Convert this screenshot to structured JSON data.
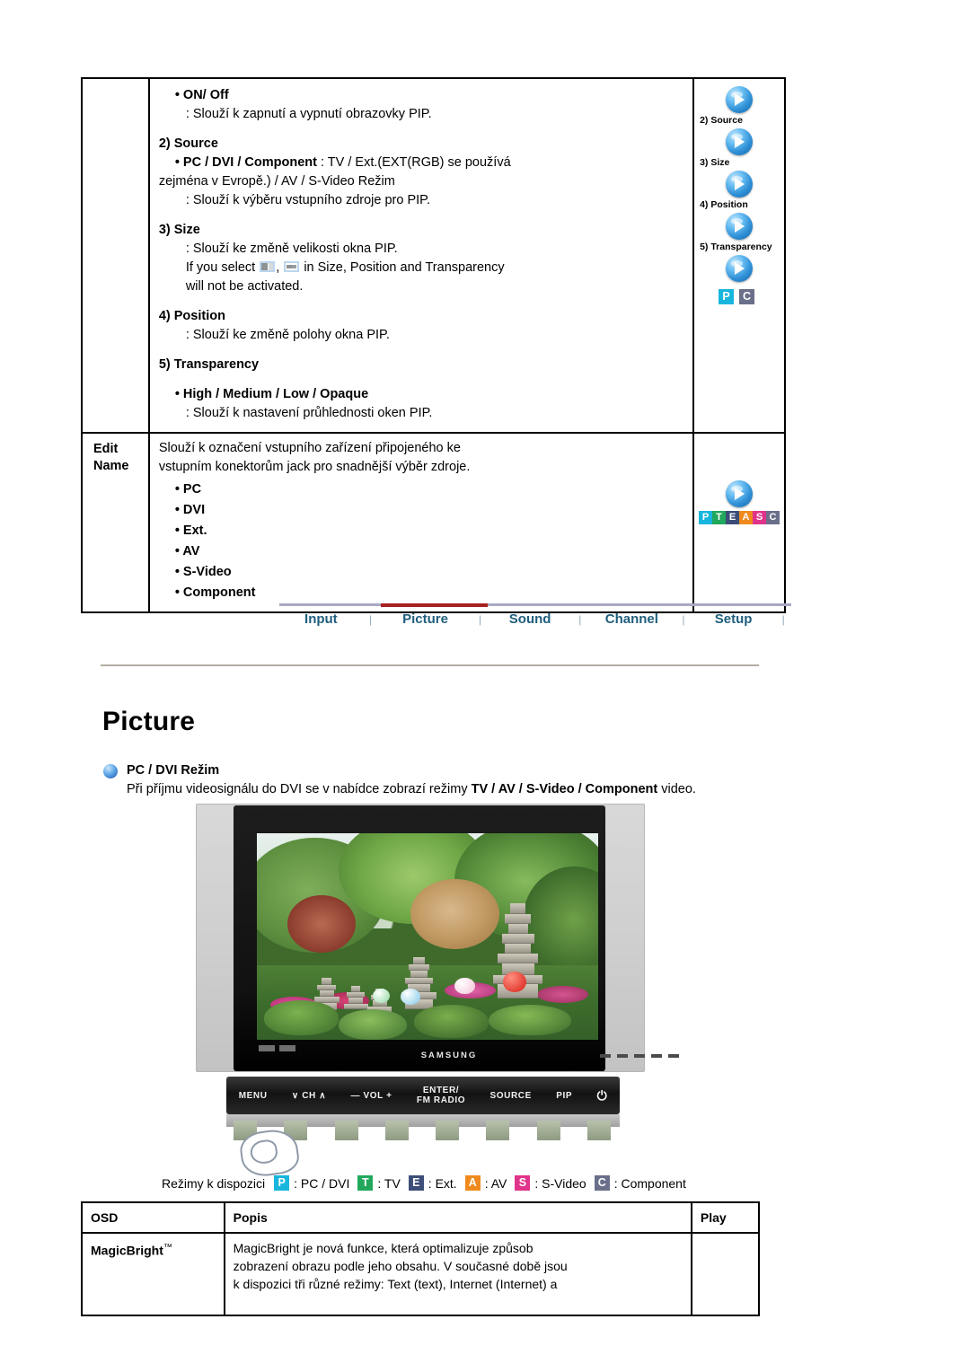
{
  "spec_table": {
    "rows": [
      {
        "label": "",
        "blocks": [
          {
            "type": "bullet-bold",
            "text": "• ON/ Off"
          },
          {
            "type": "desc",
            "text": ": Slouží k zapnutí a vypnutí obrazovky PIP."
          },
          {
            "type": "heading",
            "text": "2) Source"
          },
          {
            "type": "bullet-bold-mixed",
            "bold": "• PC / DVI / Component",
            "rest": " : TV / Ext.(EXT(RGB) se používá"
          },
          {
            "type": "cont",
            "text": "zejména v Evropě.) / AV / S-Video Režim"
          },
          {
            "type": "desc",
            "text": ": Slouží k výběru vstupního zdroje pro PIP."
          },
          {
            "type": "heading",
            "text": "3) Size"
          },
          {
            "type": "desc",
            "text": ": Slouží ke změně velikosti okna PIP."
          },
          {
            "type": "desc-icons",
            "pre": "If you select ",
            "mid": ", ",
            "post": " in Size, Position and Transparency"
          },
          {
            "type": "desc",
            "text": "will not be activated."
          },
          {
            "type": "heading",
            "text": "4) Position"
          },
          {
            "type": "desc",
            "text": ": Slouží ke změně polohy okna PIP."
          },
          {
            "type": "heading",
            "text": "5) Transparency"
          },
          {
            "type": "bullet-bold",
            "text": "• High / Medium / Low / Opaque"
          },
          {
            "type": "desc",
            "text": ": Slouží k nastavení průhlednosti oken PIP."
          }
        ],
        "icon_captions": [
          "2) Source",
          "3) Size",
          "4) Position",
          "5) Transparency"
        ],
        "icon_badges": [
          {
            "letter": "P",
            "color": "#18b6dd"
          },
          {
            "letter": "C",
            "color": "#6a6f8a"
          }
        ]
      },
      {
        "label_line1": "Edit",
        "label_line2": "Name",
        "paragraph_line1": "Slouží k označení vstupního zařízení připojeného ke",
        "paragraph_line2": "vstupním konektorům jack pro snadnější výběr zdroje.",
        "items": [
          "• PC",
          "• DVI",
          "• Ext.",
          "• AV",
          "• S-Video",
          "• Component"
        ],
        "icon_badges": [
          {
            "letter": "P",
            "color": "#18b6dd"
          },
          {
            "letter": "T",
            "color": "#22a85c"
          },
          {
            "letter": "E",
            "color": "#3c4e78"
          },
          {
            "letter": "A",
            "color": "#f08a1e"
          },
          {
            "letter": "S",
            "color": "#e0348a"
          },
          {
            "letter": "C",
            "color": "#6a6f8a"
          }
        ]
      }
    ]
  },
  "nav": {
    "items": [
      "Input",
      "Picture",
      "Sound",
      "Channel",
      "Setup"
    ],
    "active": "Picture",
    "separator": "|",
    "line_color": "#a9a8c4",
    "active_color": "#a82020",
    "text_color": "#1f5e7d"
  },
  "section": {
    "title": "Picture",
    "sub_heading": "PC / DVI Režim",
    "sub_text_pre": "Při příjmu videosignálu do DVI se v nabídce zobrazí režimy ",
    "sub_text_bold": "TV / AV / S-Video / Component",
    "sub_text_post": " video."
  },
  "tv": {
    "brand": "SAMSUNG",
    "panel_buttons": [
      "MENU",
      "∨ CH ∧",
      "— VOL +",
      "ENTER/\nFM RADIO",
      "SOURCE",
      "PIP",
      "⏻"
    ]
  },
  "legend": {
    "label": "Režimy k dispozici",
    "items": [
      {
        "letter": "P",
        "color": "#18b6dd",
        "text": ": PC / DVI"
      },
      {
        "letter": "T",
        "color": "#22a85c",
        "text": ": TV"
      },
      {
        "letter": "E",
        "color": "#3c4e78",
        "text": ": Ext."
      },
      {
        "letter": "A",
        "color": "#f08a1e",
        "text": ": AV"
      },
      {
        "letter": "S",
        "color": "#e0348a",
        "text": ": S-Video"
      },
      {
        "letter": "C",
        "color": "#6a6f8a",
        "text": ": Component"
      }
    ]
  },
  "osd_table": {
    "headers": [
      "OSD",
      "Popis",
      "Play"
    ],
    "rows": [
      {
        "name": "MagicBright",
        "trademark": "™",
        "desc_line1": "MagicBright je nová funkce, která optimalizuje způsob",
        "desc_line2": "zobrazení obrazu podle jeho obsahu. V současné době jsou",
        "desc_line3": "k dispozici tři různé režimy: Text (text), Internet (Internet) a",
        "play": ""
      }
    ]
  }
}
